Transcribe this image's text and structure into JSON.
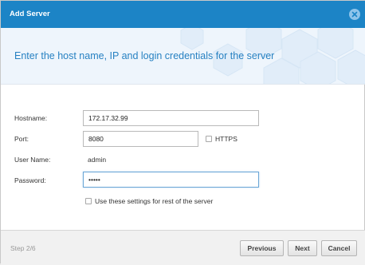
{
  "dialog": {
    "title": "Add Server",
    "heading": "Enter the host name, IP and login credentials for the server"
  },
  "form": {
    "hostname_label": "Hostname:",
    "hostname_value": "172.17.32.99",
    "port_label": "Port:",
    "port_value": "8080",
    "https_label": "HTTPS",
    "https_checked": false,
    "username_label": "User Name:",
    "username_value": "admin",
    "password_label": "Password:",
    "password_value": "•••••",
    "use_settings_label": "Use these settings for rest of the server",
    "use_settings_checked": false
  },
  "footer": {
    "step": "Step 2/6",
    "previous_label": "Previous",
    "next_label": "Next",
    "cancel_label": "Cancel"
  },
  "colors": {
    "titlebar": "#1c84c6",
    "heading": "#2781c2",
    "banner": "#eef5fc"
  },
  "icons": {
    "close": "close-icon"
  }
}
